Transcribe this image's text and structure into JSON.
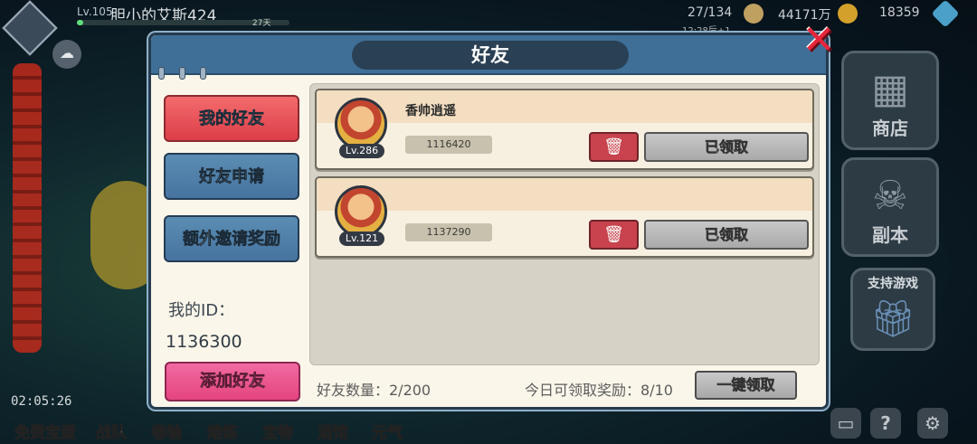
{
  "hud": {
    "level": "Lv.105",
    "player_name": "胆小的艾斯424",
    "days_badge": "27天",
    "energy": "27/134",
    "energy_timer": "12:28后+1",
    "gold": "44171万",
    "gems": "18359",
    "exp_progress": 0.03
  },
  "right_panel": {
    "shop_label": "商店",
    "dungeon_label": "副本",
    "support_label": "支持游戏"
  },
  "bottom": {
    "timer": "02:05:26",
    "nav": [
      "免费宝蛋",
      "战队",
      "卷轴",
      "熔炼",
      "宝物",
      "酒馆",
      "元气"
    ]
  },
  "modal": {
    "title": "好友",
    "tabs": {
      "my_friends": "我的好友",
      "friend_requests": "好友申请",
      "invite_rewards": "额外邀请奖励"
    },
    "my_id_label": "我的ID：",
    "my_id_value": "1136300",
    "add_friend": "添加好友",
    "friends": [
      {
        "name": "香帅逍遥",
        "level": "Lv.286",
        "id": "1116420",
        "status": "已领取"
      },
      {
        "name": "",
        "level": "Lv.121",
        "id": "1137290",
        "status": "已领取"
      }
    ],
    "friend_count": "好友数量：2/200",
    "daily_reward": "今日可领取奖励：8/10",
    "one_click": "一键领取"
  },
  "colors": {
    "header_blue": "#3f6f97",
    "active_tab": "#dc3e48",
    "normal_tab": "#4673a0",
    "add_button": "#e5447f",
    "delete_button": "#c8434d",
    "claimed_button": "#a9a9a9"
  },
  "icons": {
    "close": "close-icon",
    "delete": "trash-icon",
    "cloud": "cloud-icon"
  }
}
